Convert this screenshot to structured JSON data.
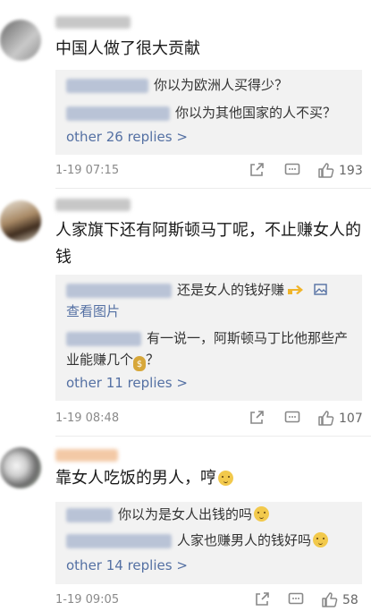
{
  "comments": [
    {
      "text": "中国人做了很大贡献",
      "replies": [
        {
          "text": "你以为欧洲人买得少？"
        },
        {
          "text": "你以为其他国家的人不买？"
        }
      ],
      "more_label": "other 26 replies >",
      "time": "1-19 07:15",
      "likes": "193"
    },
    {
      "text": "人家旗下还有阿斯顿马丁呢，不止赚女人的钱",
      "replies": [
        {
          "text": "还是女人的钱好赚",
          "link": "查看图片"
        },
        {
          "text": "有一说一，阿斯顿马丁比他那些产业能赚几个",
          "tail": "？"
        }
      ],
      "more_label": "other 11 replies >",
      "time": "1-19 08:48",
      "likes": "107"
    },
    {
      "text": "靠女人吃饭的男人，哼",
      "replies": [
        {
          "text": "你以为是女人出钱的吗"
        },
        {
          "text": "人家也赚男人的钱好吗"
        }
      ],
      "more_label": "other 14 replies >",
      "time": "1-19 09:05",
      "likes": "58"
    }
  ],
  "colors": {
    "link": "#5470a3",
    "reply_bg": "#f2f2f2",
    "meta": "#8a8a8a"
  },
  "icons": [
    "share-icon",
    "comment-icon",
    "like-icon",
    "image-icon",
    "pointing-hand-emoji",
    "money-bag-emoji",
    "doge-emoji"
  ]
}
